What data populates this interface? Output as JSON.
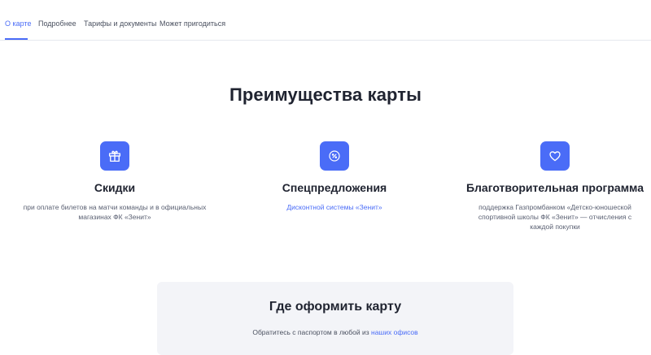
{
  "tabs": [
    {
      "label": "О карте",
      "active": true
    },
    {
      "label": "Подробнее",
      "active": false
    },
    {
      "label": "Тарифы и документы",
      "active": false
    },
    {
      "label": "Может пригодиться",
      "active": false
    }
  ],
  "section": {
    "title": "Преимущества карты"
  },
  "features": [
    {
      "icon": "gift-icon",
      "title": "Скидки",
      "description": "при оплате билетов на матчи команды и в официальных магазинах ФК «Зенит»"
    },
    {
      "icon": "percent-badge-icon",
      "title": "Спецпредложения",
      "link": "Дисконтной системы «Зенит»"
    },
    {
      "icon": "heart-icon",
      "title": "Благотворительная программа",
      "description": "поддержка Газпромбанком «Детско-юношеской спортивной школы ФК «Зенит» — отчисления с каждой покупки"
    }
  ],
  "where": {
    "title": "Где оформить карту",
    "text": "Обратитесь с паспортом в любой из ",
    "link": "наших офисов"
  },
  "colors": {
    "accent": "#4a6cf7",
    "text": "#1f2330",
    "muted": "#5a6072",
    "card_bg": "#f3f4f8"
  }
}
